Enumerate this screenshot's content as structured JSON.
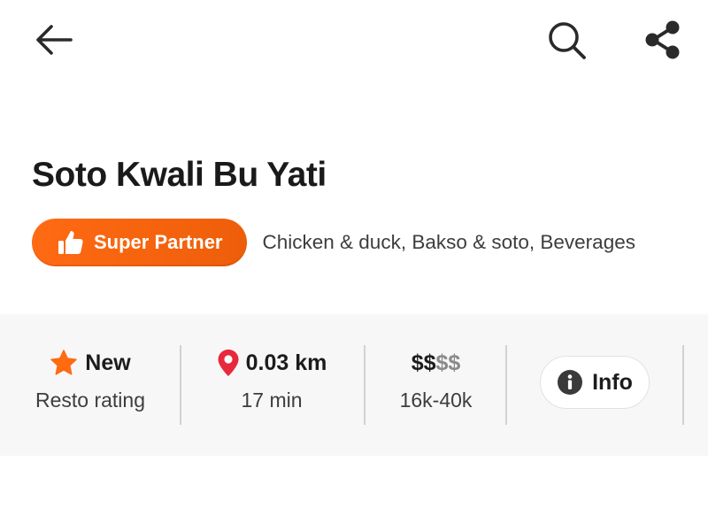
{
  "restaurant": {
    "name": "Soto Kwali Bu Yati",
    "badge": "Super Partner",
    "cuisines": "Chicken & duck, Bakso & soto, Beverages"
  },
  "stats": {
    "rating": {
      "value": "New",
      "label": "Resto rating"
    },
    "distance": {
      "value": "0.03 km",
      "label": "17 min"
    },
    "price": {
      "active": "$$",
      "inactive": "$$",
      "label": "16k-40k"
    },
    "info_label": "Info"
  },
  "icons": {
    "back": "arrow-left-icon",
    "search": "search-icon",
    "share": "share-icon",
    "badge": "thumbs-up-icon",
    "rating": "star-icon",
    "distance": "location-pin-icon",
    "info": "info-icon"
  },
  "colors": {
    "accent": "#ff6a13",
    "star": "#ff6a13",
    "pin": "#e8283c",
    "text_primary": "#1c1c1c",
    "text_secondary": "#3d3d3d",
    "price_inactive": "#8a8a8a",
    "stats_background": "#f7f7f7"
  }
}
